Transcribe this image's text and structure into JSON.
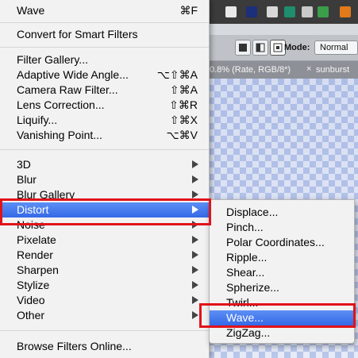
{
  "menu": {
    "top_item": {
      "label": "Wave",
      "shortcut": "⌘F"
    },
    "convert": {
      "label": "Convert for Smart Filters"
    },
    "group2": [
      {
        "label": "Filter Gallery...",
        "shortcut": ""
      },
      {
        "label": "Adaptive Wide Angle...",
        "shortcut": "⌥⇧⌘A"
      },
      {
        "label": "Camera Raw Filter...",
        "shortcut": "⇧⌘A"
      },
      {
        "label": "Lens Correction...",
        "shortcut": "⇧⌘R"
      },
      {
        "label": "Liquify...",
        "shortcut": "⇧⌘X"
      },
      {
        "label": "Vanishing Point...",
        "shortcut": "⌥⌘V"
      }
    ],
    "group3": [
      {
        "label": "3D"
      },
      {
        "label": "Blur"
      },
      {
        "label": "Blur Gallery"
      },
      {
        "label": "Distort"
      },
      {
        "label": "Noise"
      },
      {
        "label": "Pixelate"
      },
      {
        "label": "Render"
      },
      {
        "label": "Sharpen"
      },
      {
        "label": "Stylize"
      },
      {
        "label": "Video"
      },
      {
        "label": "Other"
      }
    ],
    "browse": {
      "label": "Browse Filters Online..."
    }
  },
  "submenu": {
    "items": [
      {
        "label": "Displace..."
      },
      {
        "label": "Pinch..."
      },
      {
        "label": "Polar Coordinates..."
      },
      {
        "label": "Ripple..."
      },
      {
        "label": "Shear..."
      },
      {
        "label": "Spherize..."
      },
      {
        "label": "Twirl..."
      },
      {
        "label": "Wave..."
      },
      {
        "label": "ZigZag..."
      }
    ]
  },
  "options_bar": {
    "mode_label": "Mode:",
    "mode_value": "Normal"
  },
  "tabs": {
    "doc_tab": "0.8% (Rate, RGB/8*)",
    "close_glyph": "×",
    "second_tab": "sunburst"
  },
  "colors": {
    "highlight": "#3a6ff0",
    "callout": "#e0131a"
  }
}
